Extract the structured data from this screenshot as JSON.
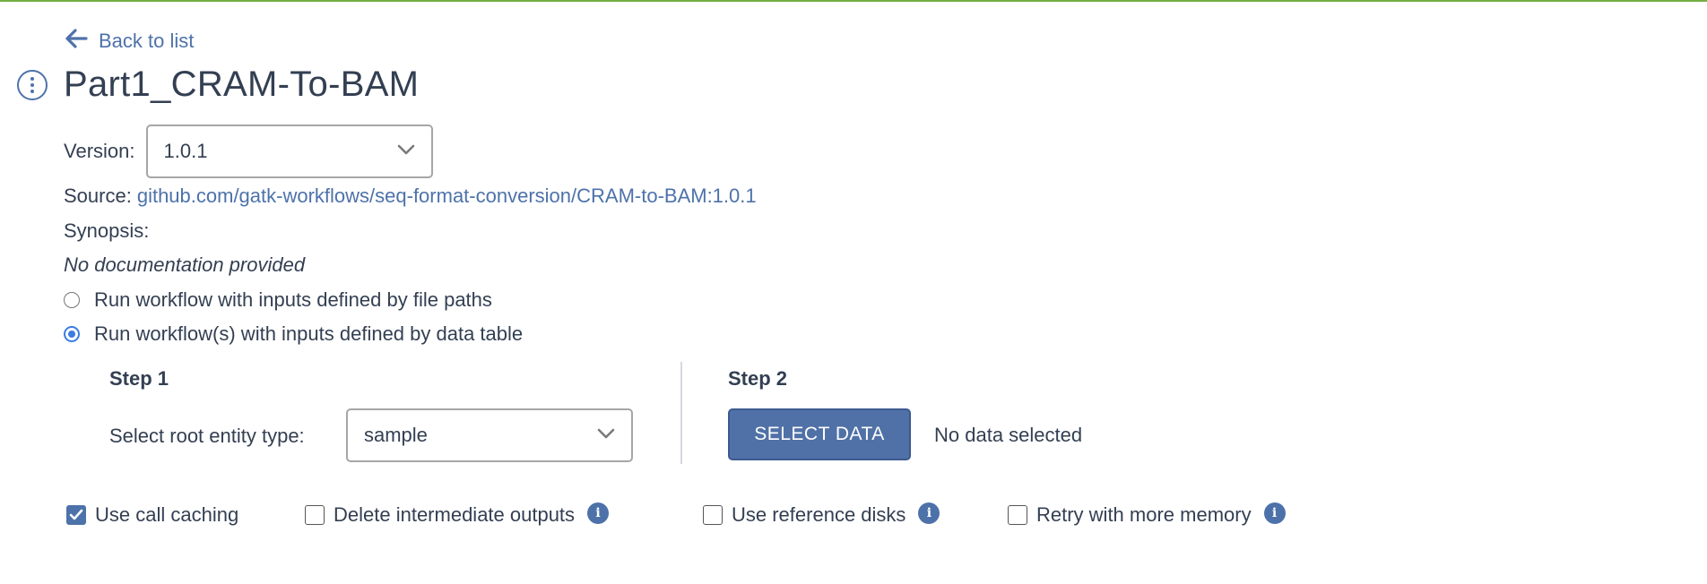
{
  "nav": {
    "back_label": "Back to list"
  },
  "workflow": {
    "title": "Part1_CRAM-To-BAM",
    "version_label": "Version:",
    "version_value": "1.0.1",
    "source_label": "Source:",
    "source_link": "github.com/gatk-workflows/seq-format-conversion/CRAM-to-BAM:1.0.1",
    "synopsis_label": "Synopsis:",
    "documentation": "No documentation provided"
  },
  "run_mode": {
    "options": [
      {
        "label": "Run workflow with inputs defined by file paths",
        "selected": false
      },
      {
        "label": "Run workflow(s) with inputs defined by data table",
        "selected": true
      }
    ]
  },
  "step1": {
    "title": "Step 1",
    "entity_label": "Select root entity type:",
    "entity_value": "sample"
  },
  "step2": {
    "title": "Step 2",
    "select_button": "SELECT DATA",
    "status": "No data selected"
  },
  "options": {
    "call_caching": {
      "label": "Use call caching",
      "checked": true
    },
    "delete_intermediate": {
      "label": "Delete intermediate outputs",
      "checked": false
    },
    "reference_disks": {
      "label": "Use reference disks",
      "checked": false
    },
    "retry_memory": {
      "label": "Retry with more memory",
      "checked": false
    }
  },
  "colors": {
    "accent": "#4d72aa",
    "topbar": "#74ae43",
    "radio_selected": "#3b7de0"
  },
  "icons": [
    "arrow-left-icon",
    "kebab-menu-icon",
    "chevron-down-icon",
    "check-icon",
    "info-icon"
  ]
}
